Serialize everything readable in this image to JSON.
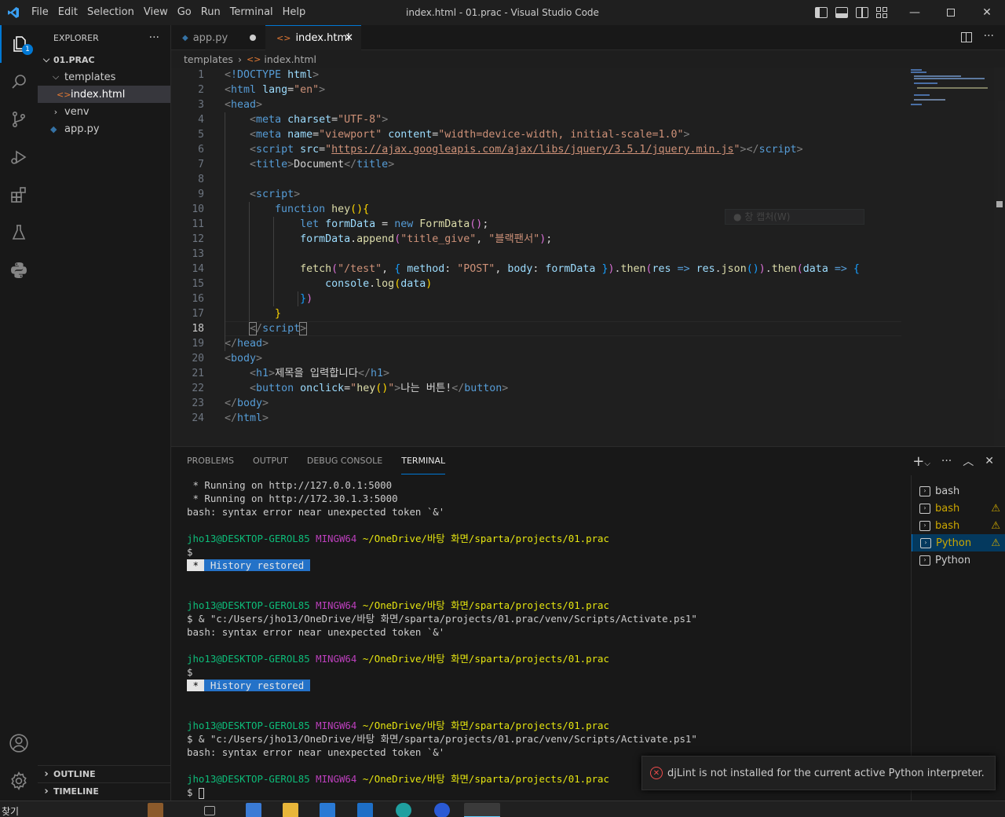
{
  "window": {
    "title": "index.html - 01.prac - Visual Studio Code"
  },
  "menu": [
    "File",
    "Edit",
    "Selection",
    "View",
    "Go",
    "Run",
    "Terminal",
    "Help"
  ],
  "activity": {
    "explorer_badge": "1"
  },
  "explorer": {
    "header": "EXPLORER",
    "more": "···",
    "project": "01.PRAC",
    "items": [
      {
        "label": "templates",
        "kind": "folder-open"
      },
      {
        "label": "index.html",
        "kind": "html",
        "selected": true
      },
      {
        "label": "venv",
        "kind": "folder"
      },
      {
        "label": "app.py",
        "kind": "python"
      }
    ],
    "outline": "OUTLINE",
    "timeline": "TIMELINE"
  },
  "tabs": [
    {
      "label": "app.py",
      "modified": true
    },
    {
      "label": "index.html",
      "active": true
    }
  ],
  "breadcrumb": [
    "templates",
    "index.html"
  ],
  "editor": {
    "current_line": "18",
    "line_numbers": [
      "1",
      "2",
      "3",
      "4",
      "5",
      "6",
      "7",
      "8",
      "9",
      "10",
      "11",
      "12",
      "13",
      "14",
      "15",
      "16",
      "17",
      "18",
      "19",
      "20",
      "21",
      "22",
      "23",
      "24"
    ],
    "hover_ghost": "창 캡처(W)"
  },
  "panel": {
    "tabs": [
      "PROBLEMS",
      "OUTPUT",
      "DEBUG CONSOLE",
      "TERMINAL"
    ],
    "active_tab": "TERMINAL",
    "terminals": [
      {
        "label": "bash",
        "warning": false
      },
      {
        "label": "bash",
        "warning": true
      },
      {
        "label": "bash",
        "warning": true
      },
      {
        "label": "Python",
        "warning": true,
        "selected": true
      },
      {
        "label": "Python",
        "warning": false
      }
    ],
    "terminal_lines": {
      "l1": " * Running on http://127.0.0.1:5000",
      "l2": " * Running on http://172.30.1.3:5000",
      "l3": "bash: syntax error near unexpected token `&'",
      "user": "jho13@DESKTOP-GEROL85",
      "shell": "MINGW64",
      "path": "~/OneDrive/바탕 화면/sparta/projects/01.prac",
      "prompt": "$",
      "history_star": " * ",
      "history": " History restored ",
      "activate": "$ & \"c:/Users/jho13/OneDrive/바탕 화면/sparta/projects/01.prac/venv/Scripts/Activate.ps1\"",
      "err": "bash: syntax error near unexpected token `&'"
    }
  },
  "notification": {
    "message": "djLint is not installed for the current active Python interpreter."
  },
  "taskbar": {
    "search": "찾기"
  }
}
